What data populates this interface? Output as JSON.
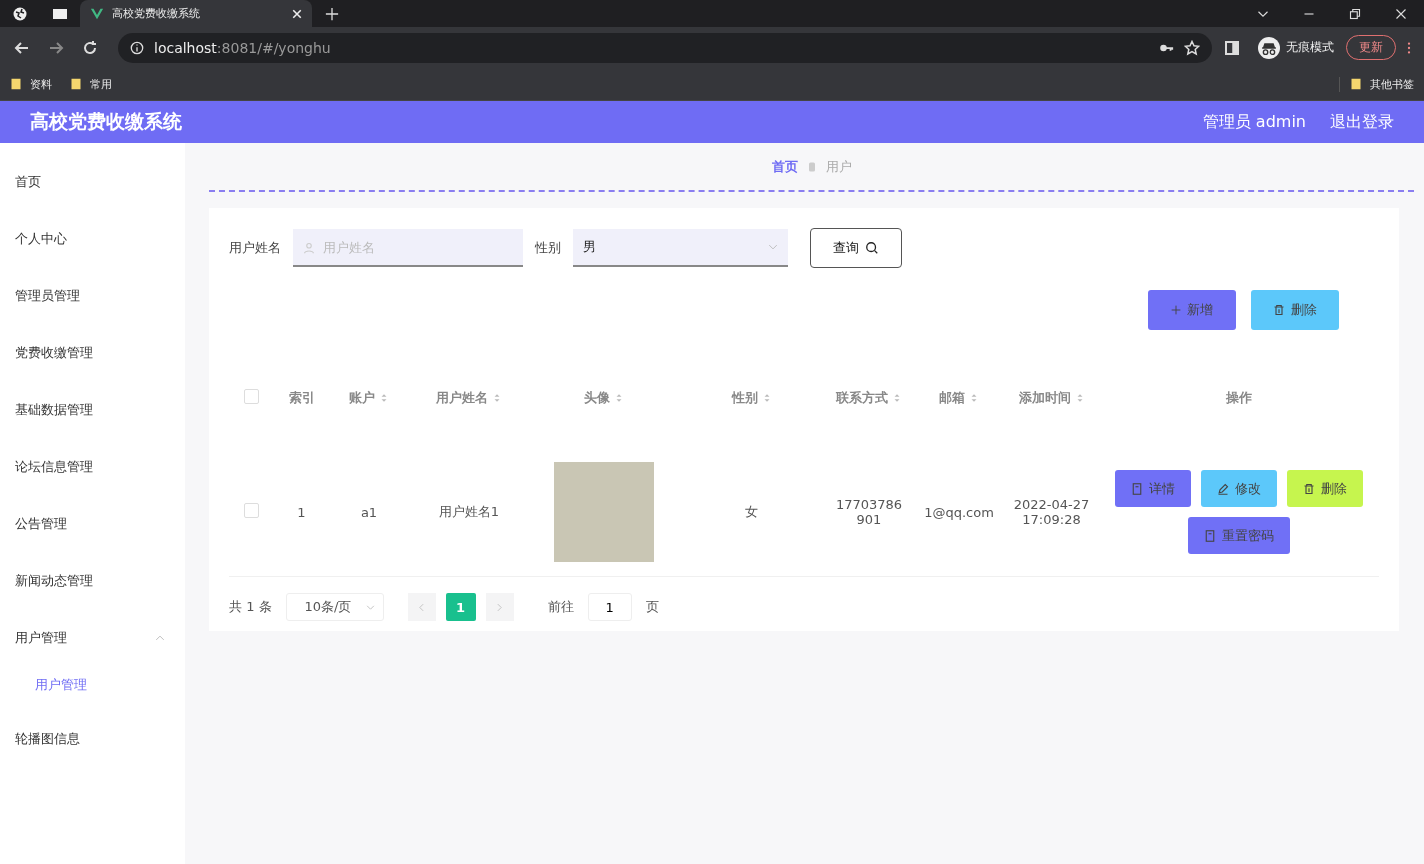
{
  "browser": {
    "tabs": [
      {
        "title": "高校党费收缴系统",
        "selected": true
      }
    ],
    "url": {
      "host": "localhost",
      "rest": ":8081/#/yonghu"
    },
    "profile_label": "无痕模式",
    "update_button": "更新",
    "bookmarks": [
      {
        "label": "资料"
      },
      {
        "label": "常用"
      }
    ],
    "other_bookmarks": "其他书签"
  },
  "header": {
    "title": "高校党费收缴系统",
    "user": "管理员 admin",
    "logout": "退出登录"
  },
  "sidebar": {
    "items": [
      {
        "label": "首页",
        "selected": false
      },
      {
        "label": "个人中心",
        "selected": false
      },
      {
        "label": "管理员管理",
        "selected": false
      },
      {
        "label": "党费收缴管理",
        "selected": false
      },
      {
        "label": "基础数据管理",
        "selected": false
      },
      {
        "label": "论坛信息管理",
        "selected": false
      },
      {
        "label": "公告管理",
        "selected": false
      },
      {
        "label": "新闻动态管理",
        "selected": false
      },
      {
        "label": "用户管理",
        "selected": false,
        "expanded": true,
        "children": [
          {
            "label": "用户管理",
            "selected": true
          }
        ]
      },
      {
        "label": "轮播图信息",
        "selected": false
      }
    ]
  },
  "breadcrumb": [
    {
      "label": "首页",
      "current": false
    },
    {
      "label": "用户",
      "current": true
    }
  ],
  "search": {
    "fields": [
      {
        "kind": "text",
        "label": "用户姓名",
        "placeholder": "用户姓名"
      },
      {
        "kind": "select",
        "label": "性别",
        "value": "男"
      }
    ],
    "button": "查询"
  },
  "actions": [
    {
      "kind": "add",
      "label": "新增"
    },
    {
      "kind": "delete",
      "label": "删除"
    }
  ],
  "table": {
    "all_selected": false,
    "columns": [
      {
        "label": "索引",
        "sortable": false
      },
      {
        "label": "账户",
        "sortable": true
      },
      {
        "label": "用户姓名",
        "sortable": true
      },
      {
        "label": "头像",
        "sortable": true
      },
      {
        "label": "性别",
        "sortable": true
      },
      {
        "label": "联系方式",
        "sortable": true
      },
      {
        "label": "邮箱",
        "sortable": true
      },
      {
        "label": "添加时间",
        "sortable": true
      },
      {
        "label": "操作",
        "sortable": false
      }
    ],
    "rows": [
      {
        "checked": false,
        "cells": [
          {
            "kind": "text",
            "text": "1"
          },
          {
            "kind": "text",
            "text": "a1"
          },
          {
            "kind": "text",
            "text": "用户姓名1"
          },
          {
            "kind": "photo"
          },
          {
            "kind": "text",
            "text": "女"
          },
          {
            "kind": "text",
            "text": "17703786901"
          },
          {
            "kind": "text",
            "text": "1@qq.com"
          },
          {
            "kind": "text",
            "text": "2022-04-27 17:09:28"
          }
        ],
        "actions": [
          {
            "kind": "detail",
            "label": "详情"
          },
          {
            "kind": "edit",
            "label": "修改"
          },
          {
            "kind": "delete",
            "label": "删除"
          },
          {
            "kind": "reset",
            "label": "重置密码"
          }
        ]
      }
    ]
  },
  "pagination": {
    "total": "共 1 条",
    "page_size": "10条/页",
    "pages": [
      {
        "label": "1",
        "selected": true
      }
    ],
    "goto_label": "前往",
    "goto_value": "1",
    "goto_suffix": "页"
  }
}
